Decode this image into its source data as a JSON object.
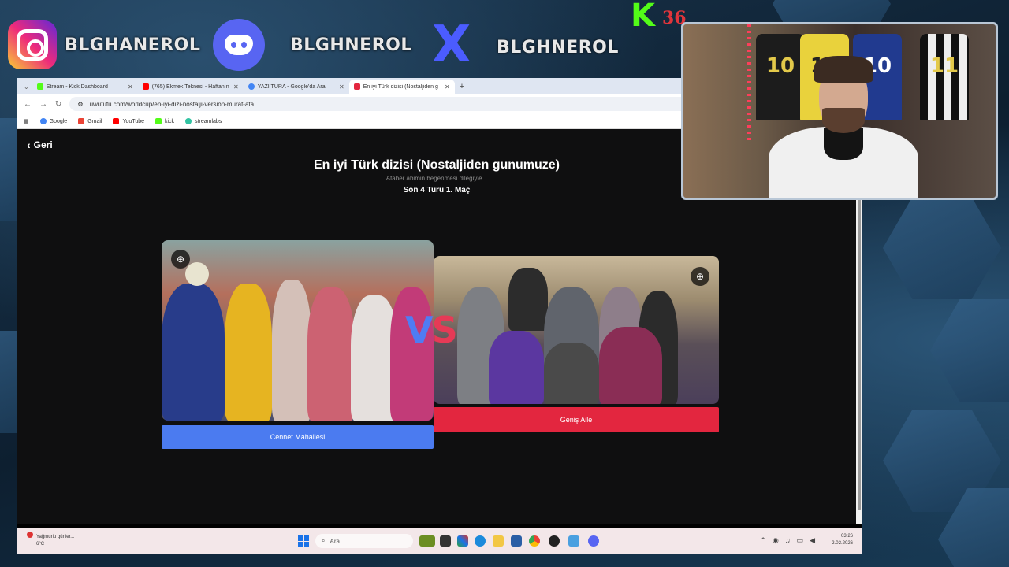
{
  "social": {
    "instagram_handle": "BLGHANEROL",
    "discord_handle": "BLGHNEROL",
    "x_handle": "BLGHNEROL",
    "x_glyph": "X",
    "kick_letter": "K",
    "kick_number": "36"
  },
  "browser": {
    "tabs": [
      {
        "title": "Stream - Kick Dashboard",
        "favicon_color": "#53fc18"
      },
      {
        "title": "(765) Ekmek Teknesi - Haftanın",
        "favicon_color": "#ff0000"
      },
      {
        "title": "YAZI TURA - Google'da Ara",
        "favicon_color": "#4285f4"
      },
      {
        "title": "En iyi Türk dizisi (Nostaljiden g",
        "favicon_color": "#e3263f",
        "active": true
      }
    ],
    "new_tab": "+",
    "url": "uwufufu.com/worldcup/en-iyi-dizi-nostalji-version-murat-ata",
    "bookmarks": [
      {
        "label": "Google",
        "color": "#4285f4"
      },
      {
        "label": "Gmail",
        "color": "#ea4335"
      },
      {
        "label": "YouTube",
        "color": "#ff0000"
      },
      {
        "label": "kick",
        "color": "#53fc18"
      },
      {
        "label": "streamlabs",
        "color": "#31c3a2"
      }
    ]
  },
  "page": {
    "back_label": "Geri",
    "title": "En iyi Türk dizisi (Nostaljiden gunumuze)",
    "subtitle": "Ataber abimin begenmesi dilegiyle...",
    "round": "Son 4 Turu 1. Maç",
    "vs_v": "V",
    "vs_s": "S",
    "left_choice": "Cennet Mahallesi",
    "right_choice": "Geniş Aile",
    "zoom_icon": "⊕"
  },
  "taskbar": {
    "weather_line1": "Yağmurlu günler...",
    "weather_line2": "6°C",
    "search_placeholder": "Ara",
    "time": "03:26",
    "date": "2.02.2026"
  },
  "webcam": {
    "jersey_numbers": [
      "10",
      "10",
      "10",
      "11"
    ]
  }
}
